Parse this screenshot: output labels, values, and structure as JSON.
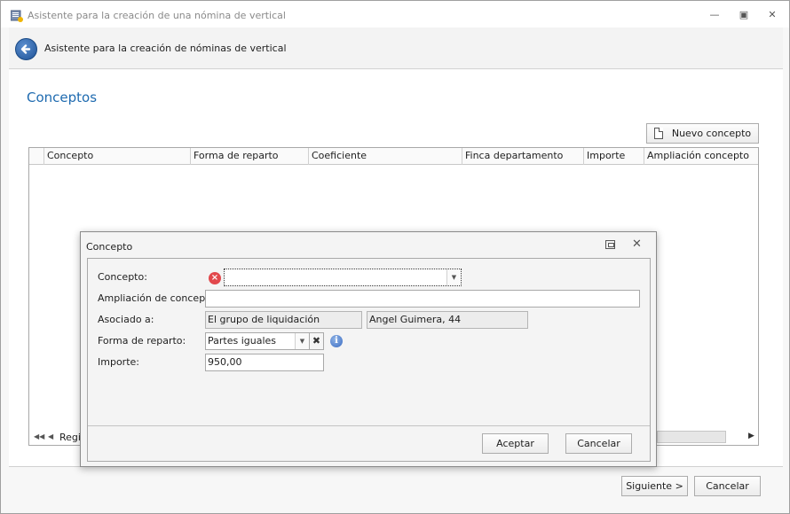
{
  "window": {
    "title": "Asistente para la creación de una nómina de vertical",
    "minimize_icon": "minimize-icon",
    "maximize_icon": "maximize-icon",
    "close_icon": "close-icon"
  },
  "wizard": {
    "title": "Asistente para la creación de nóminas de vertical",
    "page_title": "Conceptos",
    "new_concept_label": "Nuevo concepto",
    "next_label": "Siguiente >",
    "cancel_label": "Cancelar"
  },
  "grid": {
    "columns": [
      "Concepto",
      "Forma de reparto",
      "Coeficiente",
      "Finca departamento",
      "Importe",
      "Ampliación concepto"
    ],
    "rows": [],
    "nav_text": "Regis"
  },
  "dialog": {
    "title": "Concepto",
    "fields": {
      "concepto": {
        "label": "Concepto:",
        "value": ""
      },
      "ampliacion": {
        "label": "Ampliación de concepto:",
        "value": ""
      },
      "asociado": {
        "label": "Asociado a:",
        "value1": "El grupo de liquidación",
        "value2": "Angel Guimera, 44"
      },
      "forma_reparto": {
        "label": "Forma de reparto:",
        "value": "Partes iguales"
      },
      "importe": {
        "label": "Importe:",
        "value": "950,00"
      }
    },
    "accept_label": "Aceptar",
    "cancel_label": "Cancelar"
  },
  "colors": {
    "accent": "#1f6bb0",
    "error": "#e2484c",
    "info": "#3b6cc2"
  }
}
